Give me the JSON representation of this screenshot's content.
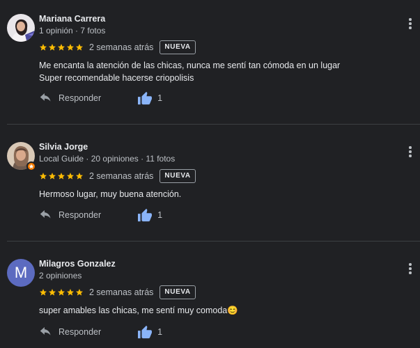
{
  "reviews": [
    {
      "name": "Mariana Carrera",
      "meta": "1 opinión · 7 fotos",
      "avatar_type": "photo",
      "rating": 5,
      "time": "2 semanas atrás",
      "badge": "NUEVA",
      "text_lines": [
        "Me encanta la atención de las chicas, nunca me sentí tan cómoda en un lugar",
        "Super recomendable hacerse criopolisis"
      ],
      "reply_label": "Responder",
      "likes": "1"
    },
    {
      "name": "Silvia Jorge",
      "meta": "Local Guide · 20 opiniones · 11 fotos",
      "avatar_type": "photo-local-guide",
      "rating": 5,
      "time": "2 semanas atrás",
      "badge": "NUEVA",
      "text_lines": [
        "Hermoso lugar, muy buena atención."
      ],
      "reply_label": "Responder",
      "likes": "1"
    },
    {
      "name": "Milagros Gonzalez",
      "meta": "2 opiniones",
      "avatar_type": "letter",
      "avatar_letter": "M",
      "rating": 5,
      "time": "2 semanas atrás",
      "badge": "NUEVA",
      "text_lines": [
        "super amables las chicas, me sentí muy comoda"
      ],
      "emoji": "😊",
      "reply_label": "Responder",
      "likes": "1"
    }
  ],
  "colors": {
    "background": "#202124",
    "star": "#fbbc04",
    "like": "#8ab4f8",
    "avatar_letter_bg": "#5c6bc0",
    "local_guide_badge": "#f57c00"
  },
  "icons": {
    "star": "star-icon",
    "reply": "reply-arrow-icon",
    "like": "thumb-up-icon",
    "more": "more-vert-icon"
  }
}
